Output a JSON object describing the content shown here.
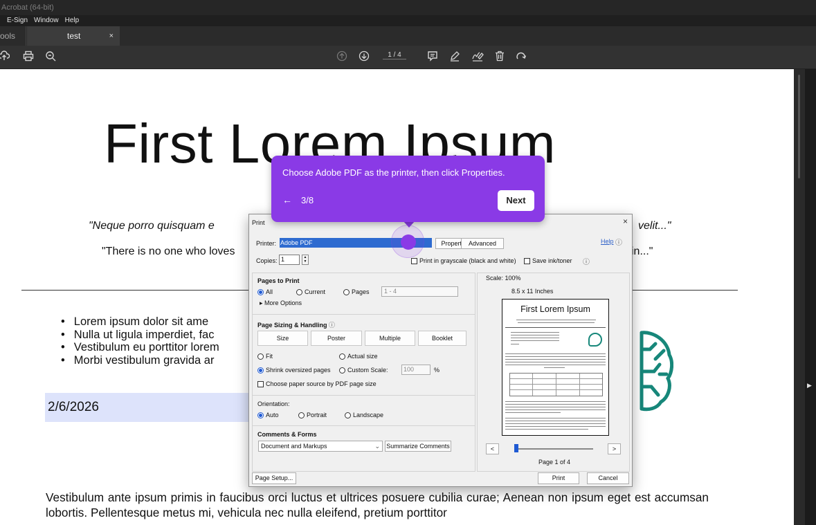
{
  "app": {
    "title": "Acrobat (64-bit)"
  },
  "menu": [
    "E-Sign",
    "Window",
    "Help"
  ],
  "tabs": {
    "tools": "ools",
    "doc": "test",
    "close": "×"
  },
  "toolbar": {
    "page": "1 / 4",
    "left_icons": [
      "cloud-upload-icon",
      "print-icon",
      "zoom-icon"
    ],
    "nav_icons": [
      "page-up-icon",
      "page-down-icon"
    ],
    "right_icons": [
      "comment-icon",
      "highlight-icon",
      "sign-icon",
      "delete-icon",
      "rotate-icon"
    ]
  },
  "document": {
    "title": "First Lorem Ipsum",
    "quote1": "\"Neque porro quisquam e",
    "quote1_end": "velit...\"",
    "quote2": "\"There is no one who loves",
    "quote2_end": "in...\"",
    "bullets": [
      "Lorem ipsum dolor sit ame",
      "Nulla ut ligula imperdiet, fac",
      "Vestibulum eu porttitor lorem",
      "Morbi vestibulum gravida ar"
    ],
    "date": "2/6/2026",
    "paragraph": "Vestibulum ante ipsum primis in faucibus orci luctus et ultrices posuere cubilia curae; Aenean non ipsum eget est accumsan lobortis. Pellentesque metus mi, vehicula nec nulla eleifend, pretium porttitor",
    "logo_color": "#17877a"
  },
  "print_dialog": {
    "title": "Print",
    "close": "×",
    "printer_label": "Printer:",
    "printer_value": "Adobe PDF",
    "properties": "Properties",
    "advanced": "Advanced",
    "help": "Help",
    "copies_label": "Copies:",
    "copies_value": "1",
    "grayscale": "Print in grayscale (black and white)",
    "save_ink": "Save ink/toner",
    "pages_to_print": {
      "heading": "Pages to Print",
      "all": "All",
      "current": "Current",
      "pages": "Pages",
      "pages_value": "1 - 4",
      "more_options": "More Options"
    },
    "sizing": {
      "heading": "Page Sizing & Handling",
      "buttons": [
        "Size",
        "Poster",
        "Multiple",
        "Booklet"
      ],
      "fit": "Fit",
      "actual": "Actual size",
      "shrink": "Shrink oversized pages",
      "custom": "Custom Scale:",
      "custom_value": "100",
      "percent": "%",
      "paper_source": "Choose paper source by PDF page size"
    },
    "orientation": {
      "heading": "Orientation:",
      "auto": "Auto",
      "portrait": "Portrait",
      "landscape": "Landscape"
    },
    "comments": {
      "heading": "Comments & Forms",
      "value": "Document and Markups",
      "summarize": "Summarize Comments"
    },
    "preview": {
      "scale": "Scale: 100%",
      "paper": "8.5 x 11 Inches",
      "page_title": "First Lorem Ipsum",
      "page_of": "Page 1 of 4",
      "prev": "<",
      "next": ">",
      "current_page": 1,
      "total_pages": 4
    },
    "page_setup": "Page Setup...",
    "print": "Print",
    "cancel": "Cancel"
  },
  "tour": {
    "text": "Choose Adobe PDF as the printer, then click Properties.",
    "back": "←",
    "step": "3/8",
    "next": "Next",
    "color": "#8a3ae6"
  }
}
